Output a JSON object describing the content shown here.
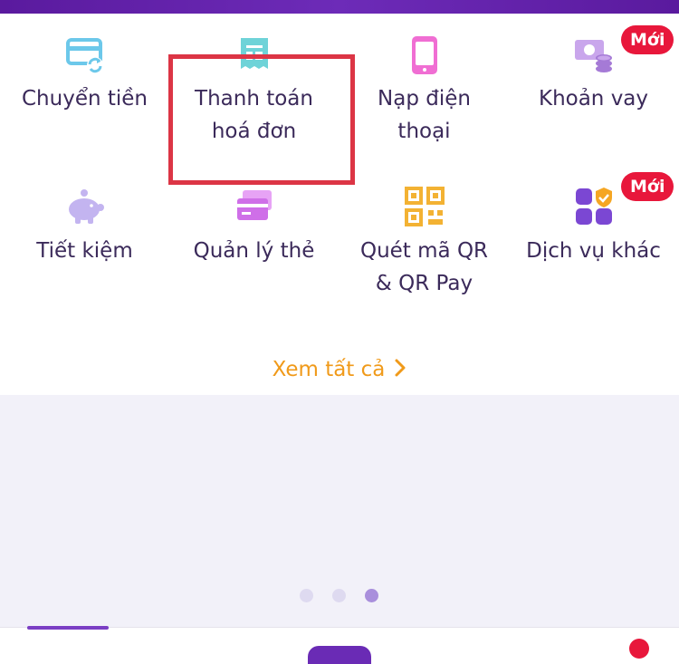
{
  "menu": {
    "tiles": [
      {
        "label": "Chuyển tiền",
        "icon": "card-transfer-icon"
      },
      {
        "label": "Thanh toán\nhoá đơn",
        "icon": "receipt-icon"
      },
      {
        "label": "Nạp điện\nthoại",
        "icon": "phone-icon"
      },
      {
        "label": "Khoản vay",
        "icon": "money-coins-icon",
        "badge": "Mới"
      },
      {
        "label": "Tiết kiệm",
        "icon": "piggy-bank-icon"
      },
      {
        "label": "Quản lý thẻ",
        "icon": "cards-icon"
      },
      {
        "label": "Quét mã QR\n& QR Pay",
        "icon": "qr-code-icon"
      },
      {
        "label": "Dịch vụ khác",
        "icon": "apps-shield-icon",
        "badge": "Mới"
      }
    ],
    "see_all_label": "Xem tất cả"
  },
  "banner": {
    "pages": 3,
    "active_page": 3
  },
  "colors": {
    "accent": "#6a2bb5",
    "see_all": "#f09a1a",
    "badge": "#e8173b",
    "highlight": "#dc3545",
    "label": "#3b2a5a"
  }
}
